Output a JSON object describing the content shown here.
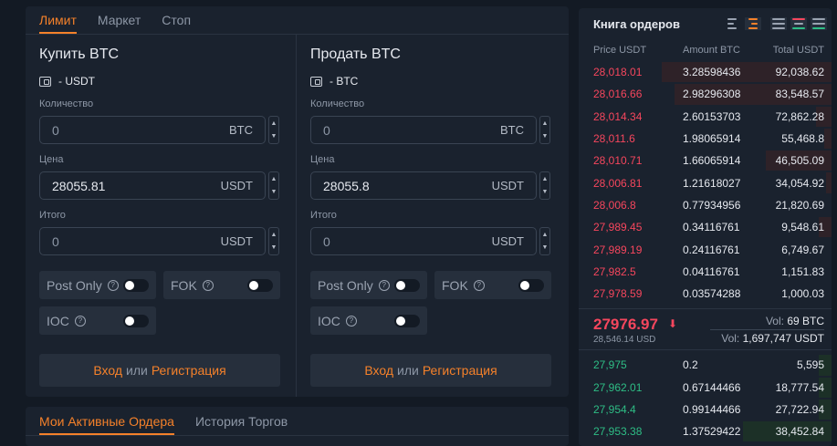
{
  "trade": {
    "tabs": [
      "Лимит",
      "Маркет",
      "Стоп"
    ],
    "buy": {
      "title": "Купить BTC",
      "balance": "- USDT",
      "qty_label": "Количество",
      "qty_value": "0",
      "qty_unit": "BTC",
      "price_label": "Цена",
      "price_value": "28055.81",
      "price_unit": "USDT",
      "total_label": "Итого",
      "total_value": "0",
      "total_unit": "USDT"
    },
    "sell": {
      "title": "Продать BTC",
      "balance": "- BTC",
      "qty_label": "Количество",
      "qty_value": "0",
      "qty_unit": "BTC",
      "price_label": "Цена",
      "price_value": "28055.8",
      "price_unit": "USDT",
      "total_label": "Итого",
      "total_value": "0",
      "total_unit": "USDT"
    },
    "options": {
      "post_only": "Post Only",
      "fok": "FOK",
      "ioc": "IOC",
      "help_glyph": "?"
    },
    "login": {
      "enter": "Вход",
      "or": "или",
      "register": "Регистрация"
    },
    "stepper": {
      "up": "▲",
      "down": "▼"
    }
  },
  "orders_tabs": [
    "Мои Активные Ордера",
    "История Торгов"
  ],
  "book": {
    "title": "Книга ордеров",
    "headers": [
      "Price USDT",
      "Amount BTC",
      "Total USDT"
    ],
    "asks": [
      {
        "price": "28,018.01",
        "amount": "3.28598436",
        "total": "92,038.62",
        "depth": 0.67
      },
      {
        "price": "28,016.66",
        "amount": "2.98296308",
        "total": "83,548.57",
        "depth": 0.62
      },
      {
        "price": "28,014.34",
        "amount": "2.60153703",
        "total": "72,862.28",
        "depth": 0.06
      },
      {
        "price": "28,011.6",
        "amount": "1.98065914",
        "total": "55,468.8",
        "depth": 0.03
      },
      {
        "price": "28,010.71",
        "amount": "1.66065914",
        "total": "46,505.09",
        "depth": 0.26
      },
      {
        "price": "28,006.81",
        "amount": "1.21618027",
        "total": "34,054.92",
        "depth": 0.02
      },
      {
        "price": "28,006.8",
        "amount": "0.77934956",
        "total": "21,820.69",
        "depth": 0.0
      },
      {
        "price": "27,989.45",
        "amount": "0.34116761",
        "total": "9,548.61",
        "depth": 0.05
      },
      {
        "price": "27,989.19",
        "amount": "0.24116761",
        "total": "6,749.67",
        "depth": 0.0
      },
      {
        "price": "27,982.5",
        "amount": "0.04116761",
        "total": "1,151.83",
        "depth": 0.0
      },
      {
        "price": "27,978.59",
        "amount": "0.03574288",
        "total": "1,000.03",
        "depth": 0.0
      }
    ],
    "last_price": "27976.97",
    "last_arrow": "⬇",
    "last_usd": "28,546.14 USD",
    "vol_btc_label": "Vol:",
    "vol_btc": "69 BTC",
    "vol_usdt_label": "Vol:",
    "vol_usdt": "1,697,747 USDT",
    "bids": [
      {
        "price": "27,975",
        "amount": "0.2",
        "total": "5,595",
        "depth": 0.05
      },
      {
        "price": "27,962.01",
        "amount": "0.67144466",
        "total": "18,777.54",
        "depth": 0.05
      },
      {
        "price": "27,954.4",
        "amount": "0.99144466",
        "total": "27,722.94",
        "depth": 0.05
      },
      {
        "price": "27,953.38",
        "amount": "1.37529422",
        "total": "38,452.84",
        "depth": 0.35
      }
    ]
  },
  "colors": {
    "accent": "#f5812a",
    "ask": "#f6465d",
    "bid": "#2ebd85",
    "panel": "#1a222e",
    "bg": "#131a24"
  }
}
